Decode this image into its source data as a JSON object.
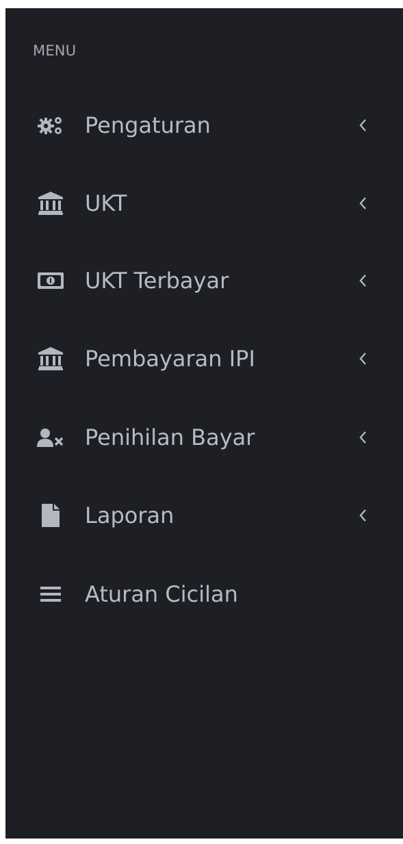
{
  "sidebar": {
    "heading": "MENU",
    "items": [
      {
        "label": "Pengaturan",
        "icon": "gears-icon",
        "has_submenu": true
      },
      {
        "label": "UKT",
        "icon": "bank-icon",
        "has_submenu": true
      },
      {
        "label": "UKT Terbayar",
        "icon": "money-bill-icon",
        "has_submenu": true
      },
      {
        "label": "Pembayaran IPI",
        "icon": "bank-icon",
        "has_submenu": true
      },
      {
        "label": "Penihilan Bayar",
        "icon": "user-times-icon",
        "has_submenu": true
      },
      {
        "label": "Laporan",
        "icon": "file-icon",
        "has_submenu": true
      },
      {
        "label": "Aturan Cicilan",
        "icon": "bars-icon",
        "has_submenu": false
      }
    ]
  },
  "colors": {
    "sidebar_bg": "#1e1f25",
    "text": "#b8bbc3",
    "icon": "#b4b7bf"
  }
}
